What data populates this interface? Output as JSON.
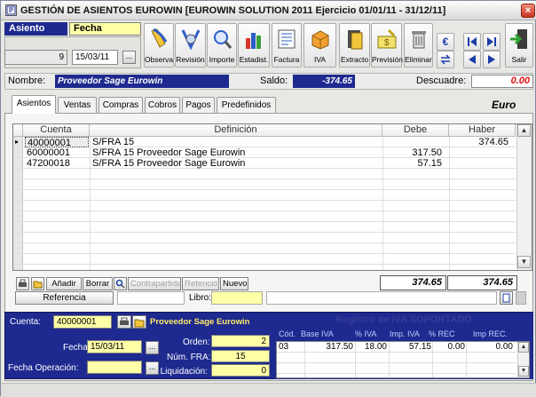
{
  "window": {
    "app_icon": "app-icon",
    "title": "GESTIÓN DE ASIENTOS EUROWIN  [EUROWIN SOLUTION 2011 Ejercicio 01/01/11 - 31/12/11]",
    "close_label": "×"
  },
  "header": {
    "asiento_label": "Asiento",
    "fecha_label": "Fecha",
    "asiento_value": "9",
    "fecha_value": "15/03/11",
    "date_picker_label": "...",
    "euro_label": "€"
  },
  "toolbar": [
    {
      "label": "Observa",
      "icon": "observations-icon"
    },
    {
      "label": "Revisión",
      "icon": "review-icon"
    },
    {
      "label": "Importe",
      "icon": "magnifier-icon"
    },
    {
      "label": "Estadist.",
      "icon": "statistics-icon"
    },
    {
      "label": "Factura",
      "icon": "invoice-icon"
    },
    {
      "label": "IVA",
      "icon": "iva-box-icon"
    },
    {
      "label": "Extracto",
      "icon": "extract-icon"
    },
    {
      "label": "Previsión",
      "icon": "forecast-icon"
    },
    {
      "label": "Eliminar",
      "icon": "trash-icon"
    },
    {
      "label": "Salir",
      "icon": "exit-icon"
    }
  ],
  "account_row": {
    "nombre_label": "Nombre:",
    "nombre_value": "Proveedor Sage Eurowin",
    "saldo_label": "Saldo:",
    "saldo_value": "-374.65",
    "descuadre_label": "Descuadre:",
    "descuadre_value": "0.00"
  },
  "tabs": [
    {
      "label": "Asientos",
      "active": true
    },
    {
      "label": "Ventas"
    },
    {
      "label": "Compras"
    },
    {
      "label": "Cobros"
    },
    {
      "label": "Pagos"
    },
    {
      "label": "Predefinidos"
    }
  ],
  "currency_label": "Euro",
  "grid": {
    "columns": [
      "Cuenta",
      "Definición",
      "Debe",
      "Haber"
    ],
    "rows": [
      {
        "cuenta": "40000001",
        "definicion": "S/FRA 15",
        "debe": "",
        "haber": "374.65",
        "current": true
      },
      {
        "cuenta": "60000001",
        "definicion": "S/FRA 15 Proveedor Sage Eurowin",
        "debe": "317.50",
        "haber": ""
      },
      {
        "cuenta": "47200018",
        "definicion": "S/FRA 15 Proveedor Sage Eurowin",
        "debe": "57.15",
        "haber": ""
      }
    ]
  },
  "grid_buttons": {
    "add": "Añadir",
    "delete": "Borrar",
    "counterpart": "Contrapartida",
    "retention": "Retención",
    "new": "Nuevo"
  },
  "totals": {
    "debe": "374.65",
    "haber": "374.65"
  },
  "reference": {
    "referencia_label": "Referencia",
    "libro_label": "Libro:",
    "libro_value": ""
  },
  "bottom": {
    "cuenta_label": "Cuenta:",
    "cuenta_value": "40000001",
    "cuenta_name": "Proveedor Sage Eurowin",
    "fecha_label": "Fecha:",
    "fecha_value": "15/03/11",
    "fecha_op_label": "Fecha Operación:",
    "fecha_op_value": "",
    "orden_label": "Orden:",
    "orden_value": "2",
    "num_fra_label": "Núm. FRA:",
    "num_fra_value": "15",
    "liquidacion_label": "Liquidación:",
    "liquidacion_value": "0"
  },
  "iva": {
    "title": "Registro de IVA SOPORTADO",
    "columns": [
      "Cód.",
      "Base IVA",
      "% IVA",
      "Imp. IVA",
      "% REC",
      "Imp REC."
    ],
    "rows": [
      {
        "cod": "03",
        "base": "317.50",
        "pct_iva": "18.00",
        "imp_iva": "57.15",
        "pct_rec": "0.00",
        "imp_rec": "0.00"
      }
    ]
  }
}
